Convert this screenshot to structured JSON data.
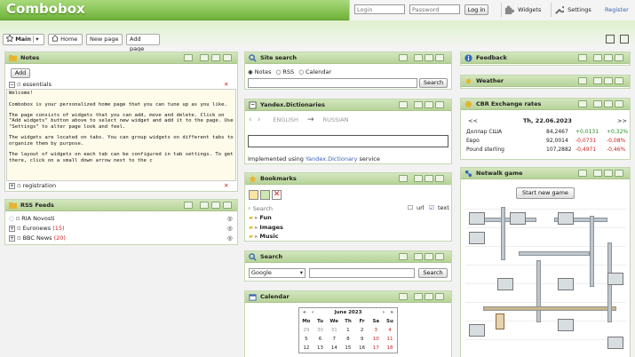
{
  "app": {
    "title": "Combobox"
  },
  "auth": {
    "login_placeholder": "Login",
    "password_placeholder": "Password",
    "login_button": "Log in",
    "widgets_label": "Widgets",
    "settings_label": "Settings",
    "register_label": "Register"
  },
  "tabs": {
    "main": "Main",
    "home": "Home",
    "new_page": "New page",
    "add_page": "Add page"
  },
  "notes": {
    "title": "Notes",
    "add_button": "Add",
    "note1_title": "essentials",
    "note1_text": "Welcome!\n\nCombobox is your personalized home page that you can tune up as you like.\n\nThe page consists of widgets that you can add, move and delete. Click on \"Add widgets\" button above to select new widget and add it to the page. Use \"Settings\" to alter page look and feel.\n\nThe widgets are located on tabs. You can group widgets on different tabs to organize them by purpose.\n\nThe layout of widgets on each tab can be configured in tab settings. To get there, click on a small down arrow next to the c",
    "note2_title": "registration"
  },
  "rss": {
    "title": "RSS Feeds",
    "feeds": [
      {
        "name": "RIA Novosti",
        "count": ""
      },
      {
        "name": "Euronews",
        "count": "(15)"
      },
      {
        "name": "BBC News",
        "count": "(20)"
      }
    ]
  },
  "site_search": {
    "title": "Site search",
    "options": [
      "Notes",
      "RSS",
      "Calendar"
    ],
    "button": "Search"
  },
  "dictionaries": {
    "title": "Yandex.Dictionaries",
    "from": "ENGLISH",
    "to": "RUSSIAN",
    "footer_prefix": "Implemented using",
    "footer_link": "Yandex.Dictionary",
    "footer_suffix": "service"
  },
  "bookmarks": {
    "title": "Bookmarks",
    "search_placeholder": "Search",
    "url_label": "url",
    "text_label": "text",
    "folders": [
      "Fun",
      "Images",
      "Music"
    ]
  },
  "search": {
    "title": "Search",
    "engine": "Google",
    "button": "Search"
  },
  "calendar": {
    "title": "Calendar",
    "month": "June 2023",
    "days": [
      "Mo",
      "Tu",
      "We",
      "Th",
      "Fr",
      "Sa",
      "Su"
    ],
    "weeks": [
      [
        "29",
        "30",
        "31",
        "1",
        "2",
        "3",
        "4"
      ],
      [
        "5",
        "6",
        "7",
        "8",
        "9",
        "10",
        "11"
      ],
      [
        "12",
        "13",
        "14",
        "15",
        "16",
        "17",
        "18"
      ]
    ]
  },
  "feedback": {
    "title": "Feedback"
  },
  "weather": {
    "title": "Weather"
  },
  "cbr": {
    "title": "CBR Exchange rates",
    "prev": "<<",
    "date": "Th, 22.06.2023",
    "next": ">>",
    "rates": [
      {
        "name": "Доллар США",
        "value": "84,2467",
        "change": "+0,0131",
        "pct": "+0,32%"
      },
      {
        "name": "Евро",
        "value": "92,0014",
        "change": "-0,0731",
        "pct": "-0,08%"
      },
      {
        "name": "Pound sterling",
        "value": "107,2882",
        "change": "-0,4971",
        "pct": "-0,46%"
      }
    ]
  },
  "netwalk": {
    "title": "Netwalk game",
    "button": "Start new game"
  },
  "colors": {
    "accent": "#6fb23a",
    "link": "#3a63b5",
    "positive": "#2a8a2a",
    "negative": "#cc2222"
  }
}
